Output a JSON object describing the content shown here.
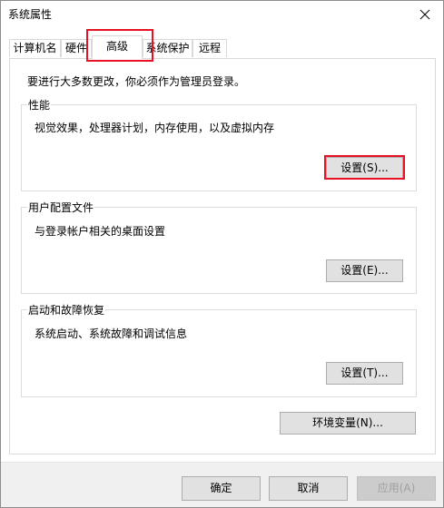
{
  "window": {
    "title": "系统属性"
  },
  "tabs": [
    {
      "label": "计算机名",
      "active": false
    },
    {
      "label": "硬件",
      "active": false
    },
    {
      "label": "高级",
      "active": true
    },
    {
      "label": "系统保护",
      "active": false
    },
    {
      "label": "远程",
      "active": false
    }
  ],
  "panel": {
    "admin_note": "要进行大多数更改，你必须作为管理员登录。",
    "performance": {
      "label": "性能",
      "description": "视觉效果，处理器计划，内存使用，以及虚拟内存",
      "button_label": "设置(S)..."
    },
    "user_profiles": {
      "label": "用户配置文件",
      "description": "与登录帐户相关的桌面设置",
      "button_label": "设置(E)..."
    },
    "startup_recovery": {
      "label": "启动和故障恢复",
      "description": "系统启动、系统故障和调试信息",
      "button_label": "设置(T)..."
    },
    "env_button_label": "环境变量(N)..."
  },
  "footer": {
    "ok_label": "确定",
    "cancel_label": "取消",
    "apply_label": "应用(A)",
    "apply_enabled": false
  },
  "colors": {
    "highlight": "#e81123",
    "button_face": "#e1e1e1",
    "disabled_text": "#a0a0a0"
  },
  "icons": {
    "close": "close-icon"
  }
}
